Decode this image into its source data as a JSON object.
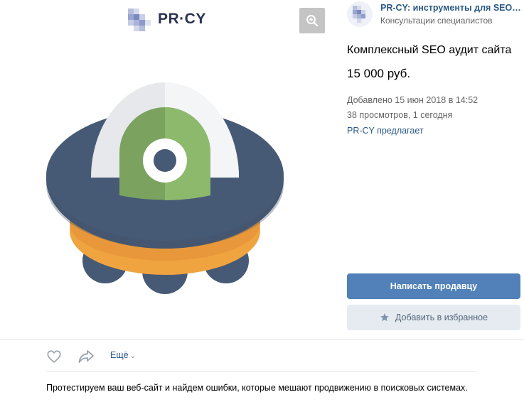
{
  "image": {
    "logo_text": "PR·CY",
    "zoom_icon": "zoom-in-icon",
    "illustration": "ufo-illustration"
  },
  "author": {
    "name": "PR-CY: инструменты для SEO и ин...",
    "category": "Консультации специалистов"
  },
  "product": {
    "title": "Комплексный SEO аудит сайта",
    "price": "15 000 руб.",
    "added": "Добавлено 15 июн 2018 в 14:52",
    "views": "38 просмотров, 1 сегодня",
    "offered_by": "PR-CY предлагает"
  },
  "buttons": {
    "write_seller": "Написать продавцу",
    "add_favorite": "Добавить в избранное"
  },
  "actions": {
    "like_icon": "heart-icon",
    "share_icon": "share-arrow-icon",
    "more": "Ещё"
  },
  "description": "Протестируем ваш веб-сайт и найдем ошибки, которые мешают продвижению в поисковых системах.",
  "colors": {
    "primary": "#5181b8",
    "link": "#2a5885",
    "secondary_bg": "#e5ebf1"
  }
}
